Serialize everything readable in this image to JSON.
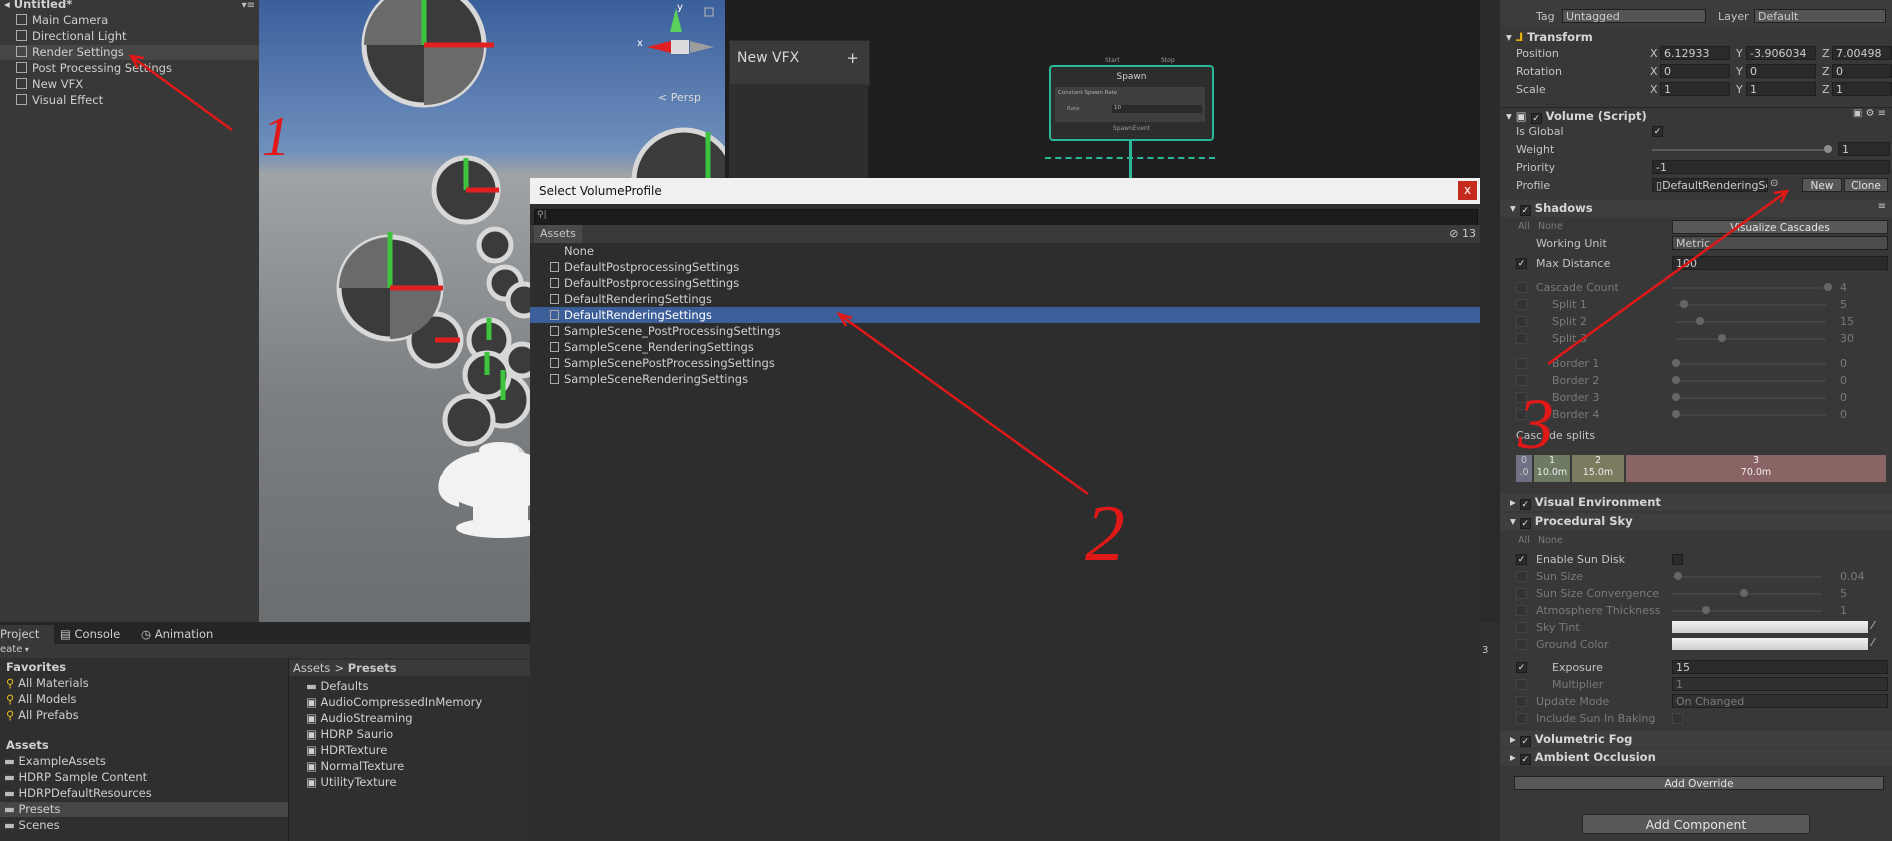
{
  "hierarchy": {
    "scene_title": "Untitled*",
    "items": [
      "Main Camera",
      "Directional Light",
      "Render Settings",
      "Post Processing Settings",
      "New VFX",
      "Visual Effect"
    ]
  },
  "scene_view": {
    "persp_label": "< Persp",
    "gizmo_x": "x",
    "gizmo_y": "y"
  },
  "vfx_graph": {
    "tab": "New VFX",
    "add": "+",
    "node_title": "Spawn",
    "node_in_start": "Start",
    "node_in_stop": "Stop",
    "block_label": "Constant Spawn Rate",
    "rate_label": "Rate",
    "rate_value": "10",
    "node_out": "SpawnEvent"
  },
  "project": {
    "tabs": [
      "Project",
      "Console",
      "Animation"
    ],
    "create_label": "eate",
    "favorites_title": "Favorites",
    "favorites": [
      "All Materials",
      "All Models",
      "All Prefabs"
    ],
    "assets_title": "Assets",
    "folders": [
      "ExampleAssets",
      "HDRP Sample Content",
      "HDRPDefaultResources",
      "Presets",
      "Scenes"
    ],
    "breadcrumb": [
      "Assets",
      "Presets"
    ],
    "files": [
      "Defaults",
      "AudioCompressedInMemory",
      "AudioStreaming",
      "HDRP Saurio",
      "HDRTexture",
      "NormalTexture",
      "UtilityTexture"
    ]
  },
  "dialog": {
    "title": "Select VolumeProfile",
    "close": "x",
    "search_placeholder": "",
    "tab": "Assets",
    "count": "13",
    "assets": [
      "None",
      "DefaultPostprocessingSettings",
      "DefaultPostprocessingSettings",
      "DefaultRenderingSettings",
      "DefaultRenderingSettings",
      "SampleScene_PostProcessingSettings",
      "SampleScene_RenderingSettings",
      "SampleScenePostProcessingSettings",
      "SampleSceneRenderingSettings"
    ],
    "selected_index": 4,
    "edge_number": "3"
  },
  "inspector": {
    "tag_label": "Tag",
    "tag_value": "Untagged",
    "layer_label": "Layer",
    "layer_value": "Default",
    "transform": {
      "title": "Transform",
      "position_label": "Position",
      "position": [
        "6.12933",
        "-3.906034",
        "7.00498"
      ],
      "rotation_label": "Rotation",
      "rotation": [
        "0",
        "0",
        "0"
      ],
      "scale_label": "Scale",
      "scale": [
        "1",
        "1",
        "1"
      ]
    },
    "volume": {
      "title": "Volume (Script)",
      "is_global": "Is Global",
      "weight_label": "Weight",
      "weight": "1",
      "priority_label": "Priority",
      "priority": "-1",
      "profile_label": "Profile",
      "profile_value": "DefaultRenderingSe",
      "new_btn": "New",
      "clone_btn": "Clone"
    },
    "shadows": {
      "title": "Shadows",
      "all": "All",
      "none": "None",
      "visualize": "Visualize Cascades",
      "working_unit_label": "Working Unit",
      "working_unit": "Metric",
      "max_distance_label": "Max Distance",
      "max_distance": "100",
      "cascade_count_label": "Cascade Count",
      "cascade_count": "4",
      "split1_label": "Split 1",
      "split1": "5",
      "split2_label": "Split 2",
      "split2": "15",
      "split3_label": "Split 3",
      "split3": "30",
      "border1_label": "Border 1",
      "border1": "0",
      "border2_label": "Border 2",
      "border2": "0",
      "border3_label": "Border 3",
      "border3": "0",
      "border4_label": "Border 4",
      "border4": "0",
      "cascade_splits_label": "Cascade splits",
      "cascades": [
        {
          "n": "0",
          "v": ".0"
        },
        {
          "n": "1",
          "v": "10.0m"
        },
        {
          "n": "2",
          "v": "15.0m"
        },
        {
          "n": "3",
          "v": "70.0m"
        }
      ],
      "cascade_colors": [
        "#6f6f86",
        "#6e7a63",
        "#7c7a5f",
        "#8a6464"
      ]
    },
    "visual_env": "Visual Environment",
    "procedural_sky": {
      "title": "Procedural Sky",
      "all": "All",
      "none": "None",
      "enable_sun_disk": "Enable Sun Disk",
      "sun_size_label": "Sun Size",
      "sun_size": "0.04",
      "sun_conv_label": "Sun Size Convergence",
      "sun_conv": "5",
      "atmo_label": "Atmosphere Thickness",
      "atmo": "1",
      "sky_tint_label": "Sky Tint",
      "ground_color_label": "Ground Color",
      "exposure_label": "Exposure",
      "exposure": "15",
      "multiplier_label": "Multiplier",
      "multiplier": "1",
      "update_mode_label": "Update Mode",
      "update_mode": "On Changed",
      "include_sun_label": "Include Sun In Baking"
    },
    "volumetric_fog": "Volumetric Fog",
    "ambient_occlusion": "Ambient Occlusion",
    "add_override": "Add Override",
    "add_component": "Add Component"
  },
  "annotations": {
    "one": "1",
    "two": "2",
    "three": "3"
  },
  "accent": {
    "selection": "#3d5f99",
    "annotation": "#e01818",
    "vfx_node": "#2bb79a"
  }
}
